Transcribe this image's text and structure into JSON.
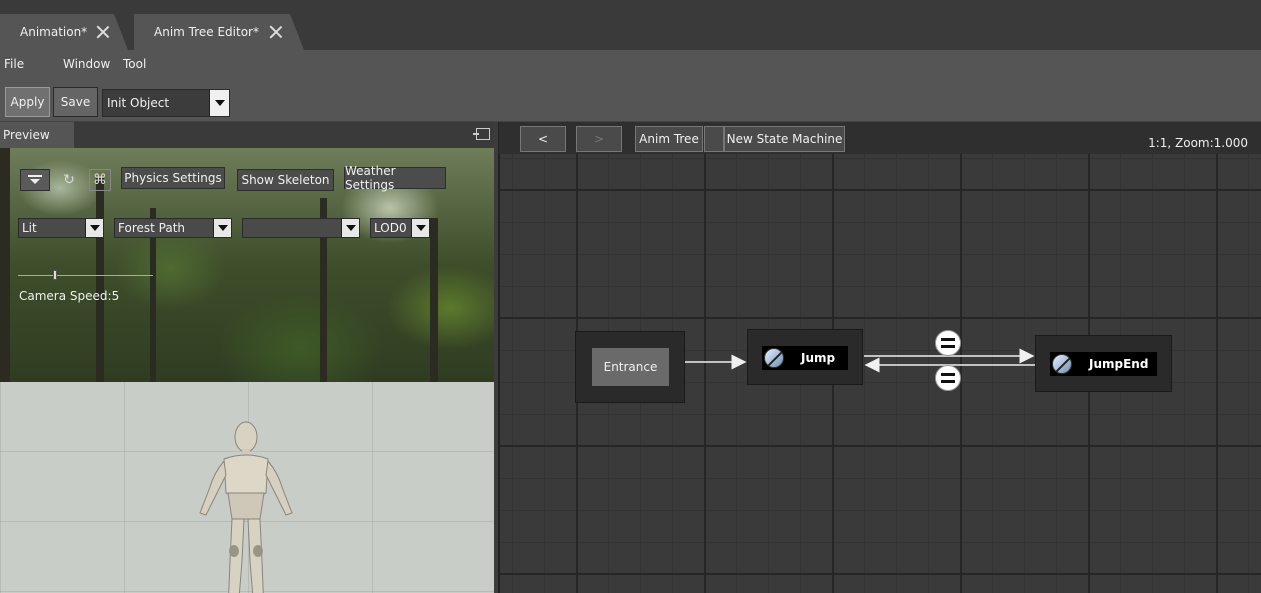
{
  "tabs": [
    {
      "label": "Animation*",
      "active": false
    },
    {
      "label": "Anim Tree Editor*",
      "active": true
    }
  ],
  "menu": {
    "file": "File",
    "window": "Window",
    "tool": "Tool"
  },
  "toolbar": {
    "apply_label": "Apply",
    "save_label": "Save",
    "object_select": "Init Object"
  },
  "preview": {
    "title": "Preview",
    "physics_settings": "Physics Settings",
    "show_skeleton": "Show Skeleton",
    "weather_settings": "Weather Settings",
    "lighting_mode": "Lit",
    "environment": "Forest Path",
    "empty_select": "",
    "lod": "LOD0",
    "camera_speed": "Camera Speed:5",
    "camera_speed_value": 5
  },
  "graph": {
    "back_label": "<",
    "forward_label": ">",
    "breadcrumb_root": "Anim Tree",
    "breadcrumb_sep": "",
    "breadcrumb_current": "New State Machine",
    "zoom_label": "1:1, Zoom:1.000",
    "nodes": {
      "entrance": "Entrance",
      "jump": "Jump",
      "jump_end": "JumpEnd"
    }
  },
  "colors": {
    "background": "#3c3c3c",
    "graph_grid": "#262626",
    "node": "#2a2a2a",
    "state_bar": "#000000"
  }
}
